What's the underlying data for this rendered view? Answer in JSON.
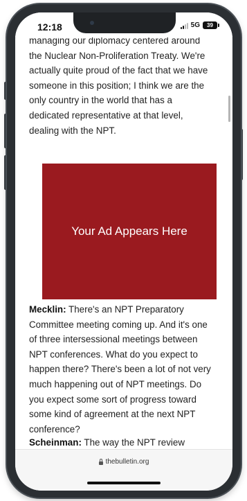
{
  "status_bar": {
    "time": "12:18",
    "network": "5G",
    "battery": "39"
  },
  "article": {
    "paragraph_top_lines": [
      "managing our diplomacy centered around",
      "the Nuclear Non-Proliferation Treaty. We're",
      "actually quite proud of the fact that we have",
      "someone in this position; I think we are the",
      "only country in the world that has a",
      "dedicated representative at that level,",
      "dealing with the NPT."
    ],
    "ad_text": "Your Ad Appears Here",
    "question_speaker": "Mecklin:",
    "question_lines": [
      " There's an NPT Preparatory",
      "Committee meeting coming up. And it's one",
      "of three intersessional meetings between",
      "NPT conferences. What do you expect to",
      "happen there? There's been a lot of not very",
      "much happening out of NPT meetings. Do",
      "you expect some sort of progress toward",
      "some kind of agreement at the next NPT",
      "conference?"
    ],
    "answer_speaker": "Scheinman:",
    "answer_start": " The way the NPT review"
  },
  "browser": {
    "url": "thebulletin.org"
  }
}
